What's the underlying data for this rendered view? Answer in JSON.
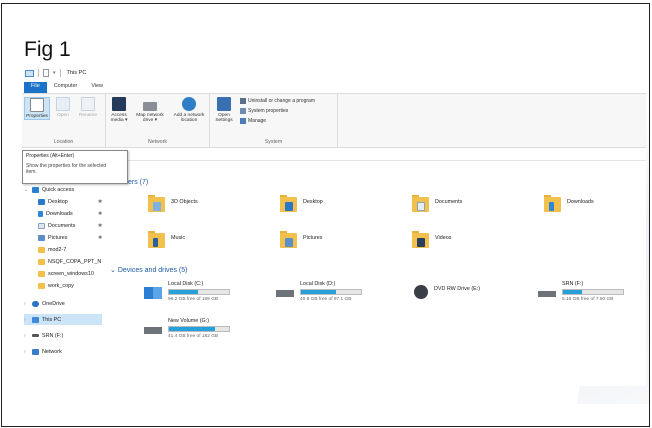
{
  "figure": {
    "label": "Fig 1"
  },
  "window": {
    "title": "This PC",
    "tabs": [
      "File",
      "Computer",
      "View"
    ]
  },
  "ribbon": {
    "location": {
      "label": "Location",
      "buttons": [
        "Properties",
        "Open",
        "Rename"
      ]
    },
    "network": {
      "label": "Network",
      "buttons": [
        "Access media ▾",
        "Map network drive ▾",
        "Add a network location"
      ]
    },
    "system": {
      "label": "System",
      "open_settings": "Open Settings",
      "items": [
        "Uninstall or change a program",
        "System properties",
        "Manage"
      ]
    }
  },
  "tooltip": {
    "title": "Properties (Alt+Enter)",
    "body": "Show the properties for the selected item."
  },
  "nav": {
    "quick_access": "Quick access",
    "items": [
      {
        "label": "Desktop",
        "pinned": true
      },
      {
        "label": "Downloads",
        "pinned": true
      },
      {
        "label": "Documents",
        "pinned": true
      },
      {
        "label": "Pictures",
        "pinned": true
      },
      {
        "label": "mod2-7",
        "pinned": false
      },
      {
        "label": "NSQF_COPA_PPT_N",
        "pinned": false
      },
      {
        "label": "screen_windows10",
        "pinned": false
      },
      {
        "label": "work_copy",
        "pinned": false
      }
    ],
    "onedrive": "OneDrive",
    "this_pc": "This PC",
    "srn": "SRN (F:)",
    "network": "Network",
    "pin_glyph": "✱"
  },
  "folders": {
    "header": "ers (7)",
    "items": [
      "3D Objects",
      "Desktop",
      "Documents",
      "Downloads",
      "Music",
      "Pictures",
      "Videos"
    ]
  },
  "drives": {
    "header": "Devices and drives (5)",
    "items": [
      {
        "name": "Local Disk (C:)",
        "free": "96.2 GB free of 185 GB",
        "used_fraction": 0.48
      },
      {
        "name": "Local Disk (D:)",
        "free": "40.9 GB free of 97.1 GB",
        "used_fraction": 0.58
      },
      {
        "name": "DVD RW Drive (E:)",
        "free": "",
        "used_fraction": null
      },
      {
        "name": "SRN (F:)",
        "free": "5.16 GB free of 7.50 GB",
        "used_fraction": 0.31
      },
      {
        "name": "New Volume (G:)",
        "free": "41.4 GB free of 182 GB",
        "used_fraction": 0.77
      }
    ]
  },
  "colors": {
    "accent": "#1a73c7",
    "folder": "#f2c04c",
    "drive_bar": "#26a0da",
    "selection": "#cce4f7",
    "section_header": "#1e5aa8"
  }
}
